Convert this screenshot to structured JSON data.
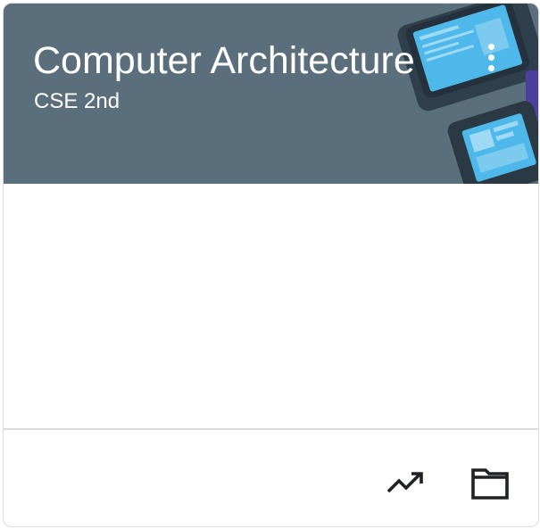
{
  "class_card": {
    "title": "Computer Architecture",
    "section": "CSE 2nd",
    "banner_color": "#5b6e7b",
    "more_icon": "more-vert-icon",
    "footer_icons": [
      "trending-up-icon",
      "folder-icon"
    ]
  }
}
